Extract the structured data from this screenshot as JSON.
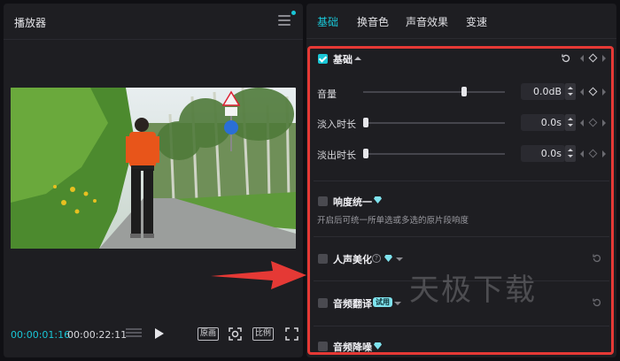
{
  "player": {
    "title": "播放器",
    "current_time": "00:00:01:16",
    "total_time": "00:00:22:11",
    "original_label": "原画",
    "ratio_label": "比例"
  },
  "tabs": [
    {
      "label": "基础",
      "active": true
    },
    {
      "label": "换音色",
      "active": false
    },
    {
      "label": "声音效果",
      "active": false
    },
    {
      "label": "变速",
      "active": false
    }
  ],
  "basic": {
    "title": "基础",
    "checked": true,
    "rows": [
      {
        "label": "音量",
        "value": "0.0dB",
        "level": 0.72
      },
      {
        "label": "淡入时长",
        "value": "0.0s",
        "level": 0.0
      },
      {
        "label": "淡出时长",
        "value": "0.0s",
        "level": 0.0
      }
    ]
  },
  "loudness": {
    "title": "响度统一",
    "checked": false,
    "description": "开启后可统一所单选或多选的原片段响度"
  },
  "voice_beautify": {
    "title": "人声美化",
    "checked": false
  },
  "audio_translate": {
    "title": "音频翻译",
    "badge": "试用",
    "checked": false
  },
  "denoise": {
    "title": "音频降噪",
    "checked": false
  },
  "watermark": "天极下载",
  "colors": {
    "accent": "#19c6d6",
    "highlight_border": "#e53935",
    "arrow": "#e53935",
    "panel_bg": "#1e1e22",
    "app_bg": "#101014"
  }
}
